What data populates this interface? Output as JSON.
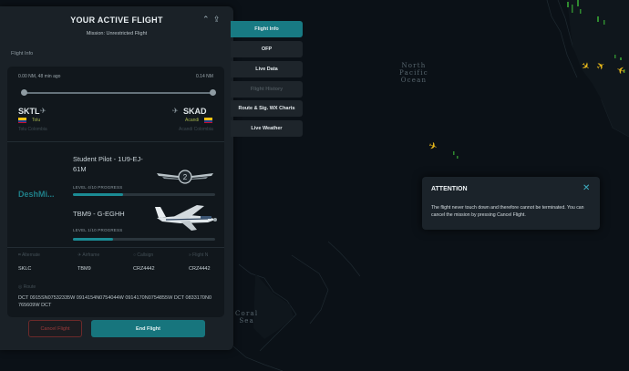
{
  "panel": {
    "title": "YOUR ACTIVE FLIGHT",
    "subtitle": "Mission: Unrestricted Flight",
    "section_label": "Flight Info",
    "distance_flown": "0.00 NM, 48 min ago",
    "distance_remaining": "0.14 NM",
    "departure": {
      "icao": "SKTL",
      "city": "Tolu",
      "airport": "Tolu Colombia",
      "flag_colors": [
        "#f3c315",
        "#213d8f",
        "#c8102e"
      ]
    },
    "arrival": {
      "icao": "SKAD",
      "city": "Acandi",
      "airport": "Acandi Colombia",
      "flag_colors": [
        "#f3c315",
        "#213d8f",
        "#c8102e"
      ]
    },
    "airline_name": "DeshMi...",
    "pilot": {
      "name": "Student Pilot - 1U9-EJ-61M",
      "progress_label": "LEVEL 4/10 PROGRESS",
      "progress": 0.35
    },
    "aircraft": {
      "name": "TBM9 - G-EGHH",
      "progress_label": "LEVEL 1/10 PROGRESS",
      "progress": 0.28
    },
    "info": [
      {
        "label": "Alternate",
        "value": "SKLC",
        "icon": "airport-icon"
      },
      {
        "label": "Airframe",
        "value": "TBM9",
        "icon": "airplane-icon"
      },
      {
        "label": "Callsign",
        "value": "CRZ4442",
        "icon": "headset-icon"
      },
      {
        "label": "Flight N",
        "value": "CRZ4442",
        "icon": "plane-takeoff-icon"
      }
    ],
    "route_label": "Route",
    "route": "DCT 0915SN07532335W 0914154N0754044W 0914170N0754855W DCT 0833170N0765609W DCT",
    "cancel_label": "Cancel Flight",
    "end_label": "End Flight"
  },
  "tabs": [
    {
      "label": "Flight Info",
      "state": "active"
    },
    {
      "label": "OFP",
      "state": "normal"
    },
    {
      "label": "Live Data",
      "state": "normal"
    },
    {
      "label": "Flight History",
      "state": "disabled"
    },
    {
      "label": "Route & Sig. WX Charts",
      "state": "normal"
    },
    {
      "label": "Live Weather",
      "state": "normal"
    }
  ],
  "map": {
    "ocean_label_lines": [
      "North",
      "Pacific",
      "Ocean"
    ],
    "sea_label_lines": [
      "Coral",
      "Sea"
    ]
  },
  "dialog": {
    "title": "ATTENTION",
    "body": "The flight never touch down and therefore cannot be terminated. You can cancel the mission by pressing Cancel Flight."
  },
  "colors": {
    "accent": "#187a83",
    "cancel": "#9e3b3b",
    "traffic": "#e8b81a"
  }
}
